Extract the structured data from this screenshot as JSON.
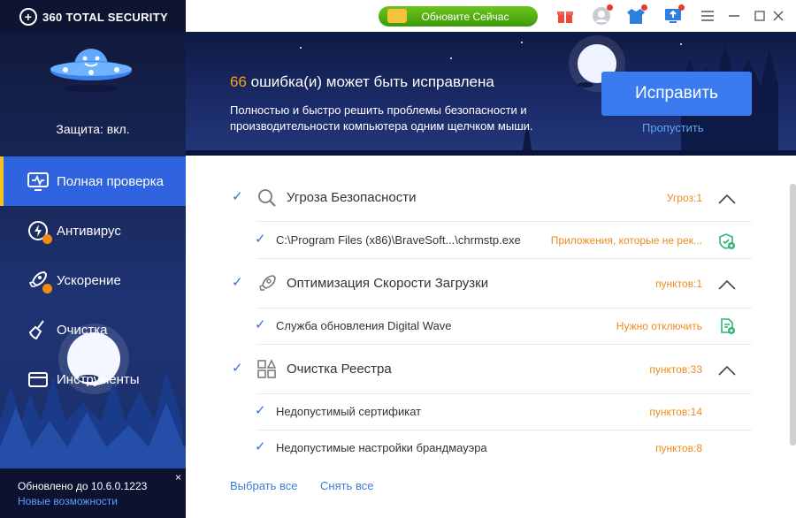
{
  "app": {
    "name": "360 TOTAL SECURITY",
    "update_button": "Обновите Сейчас"
  },
  "sidebar": {
    "protection": "Защита: вкл.",
    "items": [
      {
        "label": "Полная проверка",
        "icon": "monitor-pulse-icon",
        "active": true
      },
      {
        "label": "Антивирус",
        "icon": "shield-bolt-icon"
      },
      {
        "label": "Ускорение",
        "icon": "rocket-icon"
      },
      {
        "label": "Очистка",
        "icon": "broom-icon"
      },
      {
        "label": "Инструменты",
        "icon": "toolbox-icon"
      }
    ],
    "footer": {
      "version": "Обновлено до 10.6.0.1223",
      "news": "Новые возможности",
      "close": "×"
    }
  },
  "banner": {
    "count": "66",
    "title_rest": "ошибка(и) может быть исправлена",
    "desc_line1": "Полностью и быстро решить проблемы безопасности и",
    "desc_line2": "производительности компьютера одним щелчком мыши.",
    "fix_button": "Исправить",
    "skip_link": "Пропустить"
  },
  "sections": [
    {
      "title": "Угроза Безопасности",
      "count": "Угроз:1",
      "icon": "search-icon",
      "items": [
        {
          "label": "C:\\Program Files (x86)\\BraveSoft...\\chrmstp.exe",
          "status": "Приложения, которые не рек...",
          "action_icon": "shield-plus-icon"
        }
      ]
    },
    {
      "title": "Оптимизация Скорости Загрузки",
      "count": "пунктов:1",
      "icon": "rocket-icon",
      "items": [
        {
          "label": "Служба обновления Digital Wave",
          "status": "Нужно отключить",
          "action_icon": "document-plus-icon"
        }
      ]
    },
    {
      "title": "Очистка Реестра",
      "count": "пунктов:33",
      "icon": "registry-icon",
      "items": [
        {
          "label": "Недопустимый сертификат",
          "status": "пунктов:14"
        },
        {
          "label": "Недопустимые настройки брандмауэра",
          "status": "пунктов:8"
        }
      ]
    }
  ],
  "footer_links": {
    "select_all": "Выбрать все",
    "deselect_all": "Снять все"
  },
  "colors": {
    "accent": "#3470d6",
    "warning": "#f08a1e",
    "active_nav": "#2f63e0",
    "indicator": "#f7c21f"
  }
}
